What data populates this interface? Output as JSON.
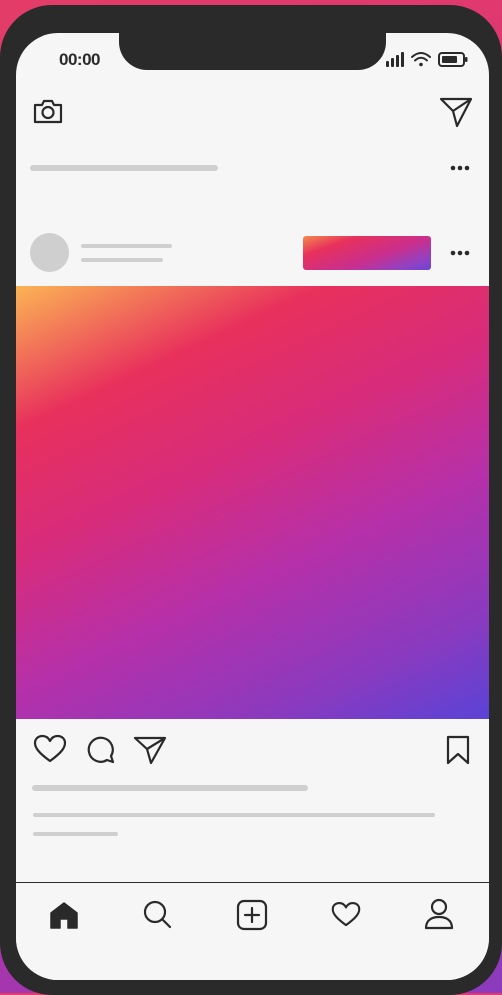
{
  "status_bar": {
    "time": "00:00",
    "icons": [
      "signal-icon",
      "wifi-icon",
      "battery-icon"
    ]
  },
  "header": {
    "left_icon": "camera-icon",
    "right_icon": "send-icon"
  },
  "stories_row": {
    "more_icon": "more-icon"
  },
  "post": {
    "follow_button_gradient": [
      "#f28b4b",
      "#e8305c",
      "#c82f8e",
      "#6b44d2"
    ],
    "image_gradient": [
      "#fbb455",
      "#e8305c",
      "#b630a9",
      "#5a43d6"
    ],
    "actions": [
      "heart-icon",
      "comment-icon",
      "send-icon"
    ],
    "save_icon": "bookmark-icon"
  },
  "bottom_nav": {
    "items": [
      "home-icon",
      "search-icon",
      "add-icon",
      "heart-icon",
      "profile-icon"
    ]
  },
  "colors": {
    "frame": "#2a2a2a",
    "screen": "#f6f6f6",
    "placeholder": "#cfcfcf"
  }
}
